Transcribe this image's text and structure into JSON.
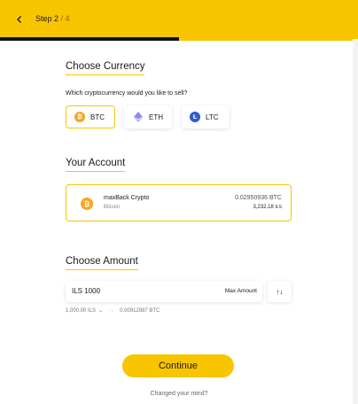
{
  "header": {
    "step_current": "Step 2",
    "step_total": "/ 4",
    "progress_fraction": 0.5,
    "accent_color": "#f9c400"
  },
  "currency_section": {
    "title": "Choose Currency",
    "question": "Which cryptocurrency would you like to sell?",
    "options": [
      {
        "label": "BTC",
        "icon": "bitcoin-icon",
        "color": "#f5a623",
        "selected": true
      },
      {
        "label": "ETH",
        "icon": "ethereum-icon",
        "color": "#8c8cf0",
        "selected": false
      },
      {
        "label": "LTC",
        "icon": "litecoin-icon",
        "color": "#2f5bd3",
        "selected": false
      }
    ]
  },
  "account_section": {
    "title": "Your Account",
    "account": {
      "name": "maxBack Crypto",
      "coin": "Bitcoin",
      "btc_balance": "0.02950936 BTC",
      "ils_balance": "3,232.18",
      "ils_unit": "ILS"
    }
  },
  "amount_section": {
    "title": "Choose Amount",
    "amount_value": "ILS 1000",
    "max_label": "Max Amount",
    "swap_icon": "↑↓",
    "conversion_from": "1,000.00 ILS",
    "conversion_to": "0.00912987 BTC"
  },
  "footer": {
    "continue_label": "Continue",
    "changed_mind_label": "Changed your mind?"
  }
}
